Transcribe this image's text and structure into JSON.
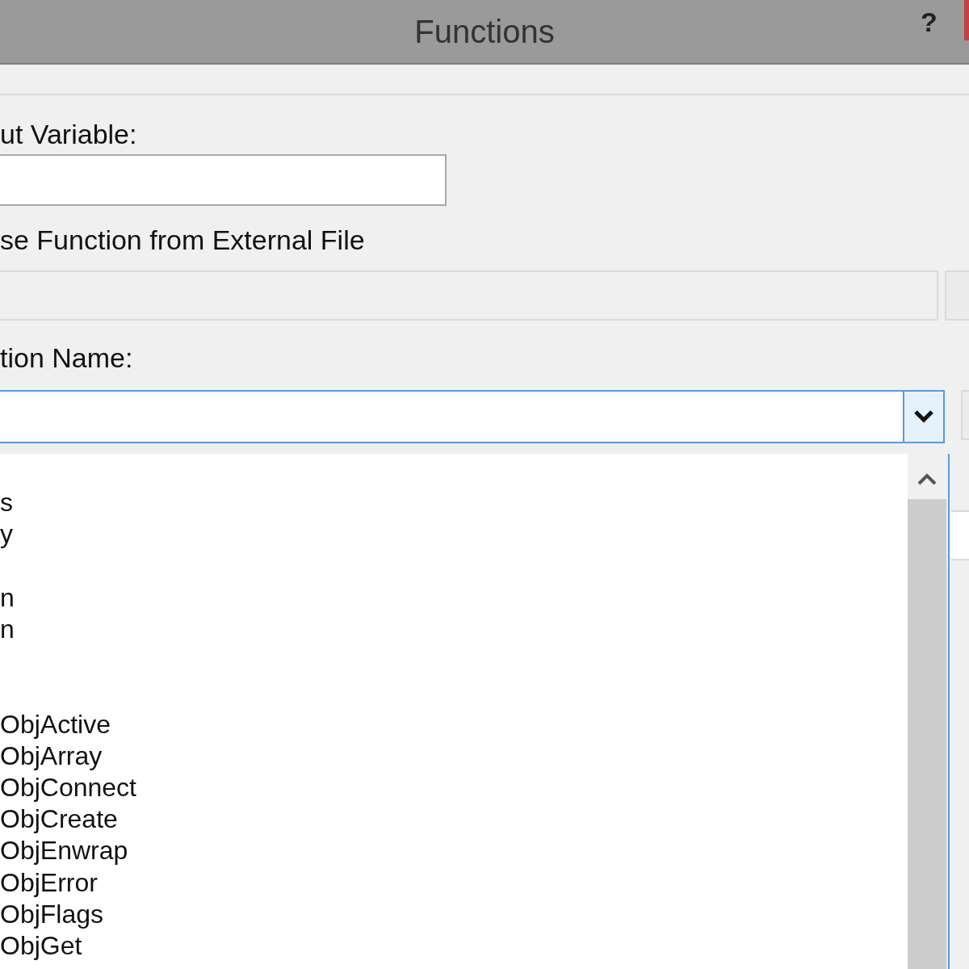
{
  "window": {
    "title": "Functions",
    "help": "?"
  },
  "output_variable": {
    "label": "ut Variable:"
  },
  "external_file": {
    "label": "se Function from External File",
    "disabled": true
  },
  "function_name": {
    "label": "tion Name:",
    "expanded": true
  },
  "dropdown_items": [
    {
      "text": "s"
    },
    {
      "text": "y"
    },
    {
      "text": "n"
    },
    {
      "text": "n"
    },
    {
      "text": "ObjActive"
    },
    {
      "text": "ObjArray"
    },
    {
      "text": "ObjConnect"
    },
    {
      "text": "ObjCreate"
    },
    {
      "text": "ObjEnwrap"
    },
    {
      "text": "ObjError"
    },
    {
      "text": "ObjFlags"
    },
    {
      "text": "ObjGet"
    }
  ]
}
